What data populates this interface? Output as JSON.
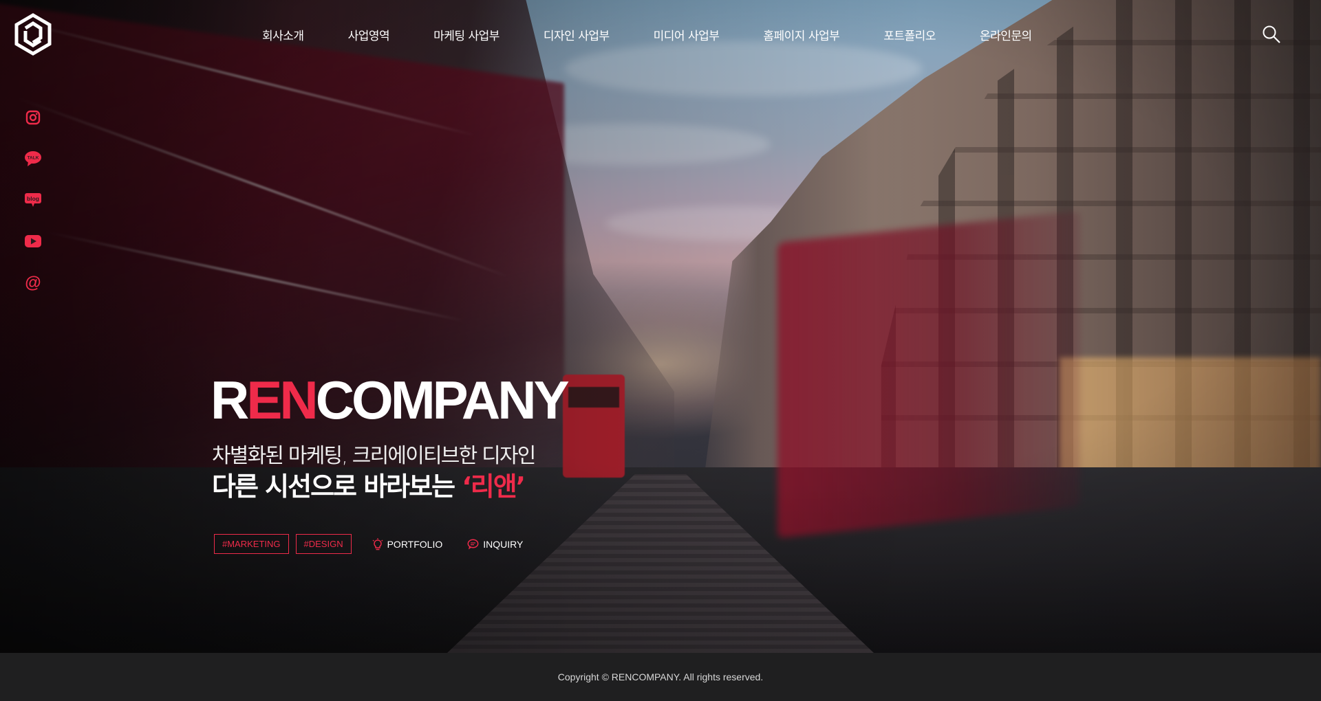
{
  "header": {
    "nav": [
      "회사소개",
      "사업영역",
      "마케팅 사업부",
      "디자인 사업부",
      "미디어 사업부",
      "홈페이지 사업부",
      "포트폴리오",
      "온라인문의"
    ]
  },
  "social": [
    {
      "icon": "instagram-icon"
    },
    {
      "icon": "kakaotalk-icon",
      "label": "TALK"
    },
    {
      "icon": "blog-icon",
      "label": "blog"
    },
    {
      "icon": "youtube-icon"
    },
    {
      "icon": "email-icon",
      "label": "@"
    }
  ],
  "hero": {
    "brand_r": "R",
    "brand_en": "EN",
    "brand_company": "COMPANY",
    "tagline1": "차별화된 마케팅, 크리에이티브한 디자인",
    "tagline2_prefix": "다른 시선으로 바라보는 ",
    "tagline2_highlight": "‘리앤’",
    "tags": [
      "#MARKETING",
      "#DESIGN"
    ],
    "portfolio_label": "PORTFOLIO",
    "inquiry_label": "INQUIRY"
  },
  "footer": {
    "copyright": "Copyright © RENCOMPANY.  All rights reserved."
  },
  "colors": {
    "accent": "#ef2b4a",
    "footer_bg": "#1f1f20",
    "text": "#ffffff"
  }
}
